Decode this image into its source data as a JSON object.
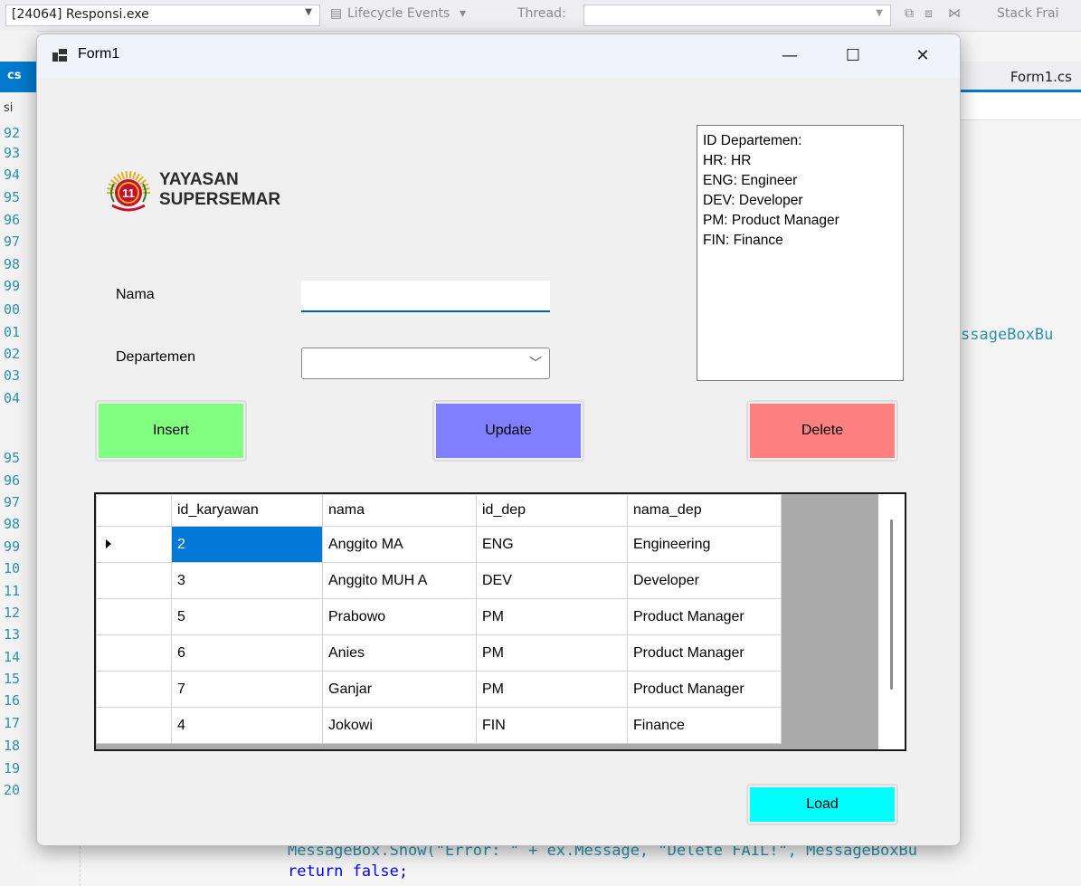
{
  "ide": {
    "process": "[24064] Responsi.exe",
    "lifecycle": "Lifecycle Events",
    "thread_label": "Thread:",
    "stack_frame": "Stack Frai",
    "left_tab": "cs",
    "left_sub": "si",
    "right_tab": "Form1.cs",
    "line_numbers": [
      "92",
      "93",
      "94",
      "95",
      "96",
      "97",
      "98",
      "99",
      "00",
      "01",
      "02",
      "03",
      "04",
      "95",
      "96",
      "97",
      "98",
      "99",
      "10",
      "11",
      "12",
      "13",
      "14",
      "15",
      "16",
      "17",
      "18",
      "19",
      "20"
    ],
    "code_right": "ssageBoxBu",
    "code_line1": "MessageBox.Show(\"Error: \" + ex.Message, \"Delete FAIL!\", MessageBoxBu",
    "code_line2": "return false;"
  },
  "window": {
    "title": "Form1",
    "minimize": "—",
    "maximize": "☐",
    "close": "✕"
  },
  "logo": {
    "line1": "YAYASAN",
    "line2": "SUPERSEMAR",
    "badge": "11",
    "colors": {
      "red": "#c8102e",
      "gold": "#e0b020"
    }
  },
  "form": {
    "nama_label": "Nama",
    "nama_value": "",
    "departemen_label": "Departemen",
    "departemen_value": ""
  },
  "info": {
    "lines": [
      "ID Departemen:",
      "HR: HR",
      "ENG: Engineer",
      "DEV: Developer",
      "PM: Product Manager",
      "FIN: Finance"
    ]
  },
  "buttons": {
    "insert": {
      "label": "Insert",
      "color": "#80ff80"
    },
    "update": {
      "label": "Update",
      "color": "#8080ff"
    },
    "delete": {
      "label": "Delete",
      "color": "#ff8080"
    },
    "load": {
      "label": "Load",
      "color": "#00ffff"
    }
  },
  "grid": {
    "columns": [
      "id_karyawan",
      "nama",
      "id_dep",
      "nama_dep"
    ],
    "rows": [
      [
        "2",
        "Anggito MA",
        "ENG",
        "Engineering"
      ],
      [
        "3",
        "Anggito MUH A",
        "DEV",
        "Developer"
      ],
      [
        "5",
        "Prabowo",
        "PM",
        "Product Manager"
      ],
      [
        "6",
        "Anies",
        "PM",
        "Product Manager"
      ],
      [
        "7",
        "Ganjar",
        "PM",
        "Product Manager"
      ],
      [
        "4",
        "Jokowi",
        "FIN",
        "Finance"
      ]
    ],
    "selected_row": 0
  }
}
